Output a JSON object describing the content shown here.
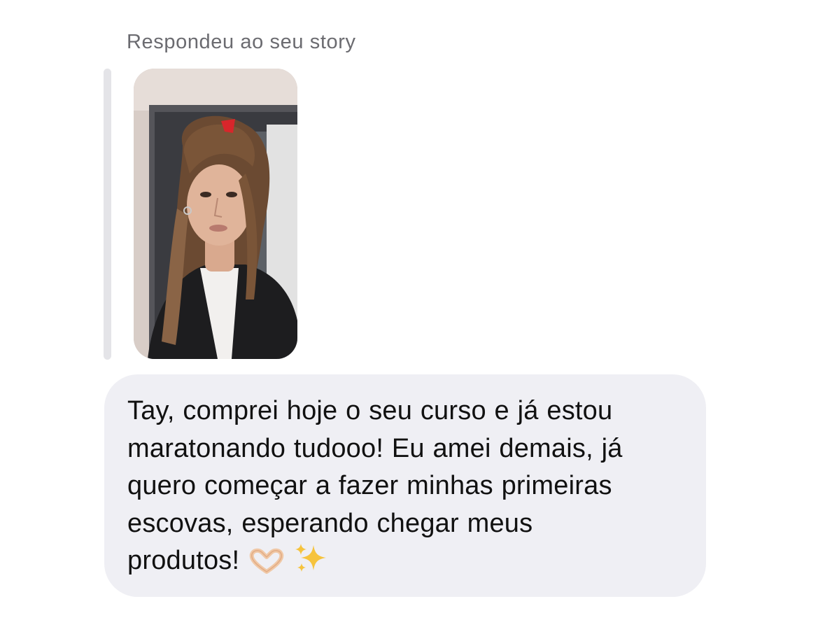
{
  "reply": {
    "caption": "Respondeu ao seu story"
  },
  "story": {
    "icon": "story-thumbnail"
  },
  "message": {
    "text": "Tay, comprei hoje o seu curso e já estou\nmaratonando tudooo! Eu amei demais, já\nquero começar a fazer minhas primeiras\nescovas, esperando chegar meus\nprodutos!",
    "emojis": [
      "heart-hands-icon",
      "sparkles-icon"
    ]
  },
  "colors": {
    "bubble": "#efeff4",
    "caption": "#6b6b70",
    "quote_bar": "#e4e4e8",
    "text": "#111111"
  }
}
